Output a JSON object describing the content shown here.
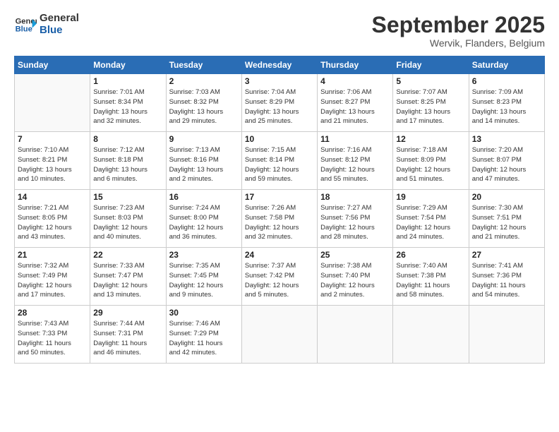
{
  "logo": {
    "line1": "General",
    "line2": "Blue"
  },
  "title": "September 2025",
  "subtitle": "Wervik, Flanders, Belgium",
  "weekdays": [
    "Sunday",
    "Monday",
    "Tuesday",
    "Wednesday",
    "Thursday",
    "Friday",
    "Saturday"
  ],
  "weeks": [
    [
      {
        "day": "",
        "detail": ""
      },
      {
        "day": "1",
        "detail": "Sunrise: 7:01 AM\nSunset: 8:34 PM\nDaylight: 13 hours\nand 32 minutes."
      },
      {
        "day": "2",
        "detail": "Sunrise: 7:03 AM\nSunset: 8:32 PM\nDaylight: 13 hours\nand 29 minutes."
      },
      {
        "day": "3",
        "detail": "Sunrise: 7:04 AM\nSunset: 8:29 PM\nDaylight: 13 hours\nand 25 minutes."
      },
      {
        "day": "4",
        "detail": "Sunrise: 7:06 AM\nSunset: 8:27 PM\nDaylight: 13 hours\nand 21 minutes."
      },
      {
        "day": "5",
        "detail": "Sunrise: 7:07 AM\nSunset: 8:25 PM\nDaylight: 13 hours\nand 17 minutes."
      },
      {
        "day": "6",
        "detail": "Sunrise: 7:09 AM\nSunset: 8:23 PM\nDaylight: 13 hours\nand 14 minutes."
      }
    ],
    [
      {
        "day": "7",
        "detail": "Sunrise: 7:10 AM\nSunset: 8:21 PM\nDaylight: 13 hours\nand 10 minutes."
      },
      {
        "day": "8",
        "detail": "Sunrise: 7:12 AM\nSunset: 8:18 PM\nDaylight: 13 hours\nand 6 minutes."
      },
      {
        "day": "9",
        "detail": "Sunrise: 7:13 AM\nSunset: 8:16 PM\nDaylight: 13 hours\nand 2 minutes."
      },
      {
        "day": "10",
        "detail": "Sunrise: 7:15 AM\nSunset: 8:14 PM\nDaylight: 12 hours\nand 59 minutes."
      },
      {
        "day": "11",
        "detail": "Sunrise: 7:16 AM\nSunset: 8:12 PM\nDaylight: 12 hours\nand 55 minutes."
      },
      {
        "day": "12",
        "detail": "Sunrise: 7:18 AM\nSunset: 8:09 PM\nDaylight: 12 hours\nand 51 minutes."
      },
      {
        "day": "13",
        "detail": "Sunrise: 7:20 AM\nSunset: 8:07 PM\nDaylight: 12 hours\nand 47 minutes."
      }
    ],
    [
      {
        "day": "14",
        "detail": "Sunrise: 7:21 AM\nSunset: 8:05 PM\nDaylight: 12 hours\nand 43 minutes."
      },
      {
        "day": "15",
        "detail": "Sunrise: 7:23 AM\nSunset: 8:03 PM\nDaylight: 12 hours\nand 40 minutes."
      },
      {
        "day": "16",
        "detail": "Sunrise: 7:24 AM\nSunset: 8:00 PM\nDaylight: 12 hours\nand 36 minutes."
      },
      {
        "day": "17",
        "detail": "Sunrise: 7:26 AM\nSunset: 7:58 PM\nDaylight: 12 hours\nand 32 minutes."
      },
      {
        "day": "18",
        "detail": "Sunrise: 7:27 AM\nSunset: 7:56 PM\nDaylight: 12 hours\nand 28 minutes."
      },
      {
        "day": "19",
        "detail": "Sunrise: 7:29 AM\nSunset: 7:54 PM\nDaylight: 12 hours\nand 24 minutes."
      },
      {
        "day": "20",
        "detail": "Sunrise: 7:30 AM\nSunset: 7:51 PM\nDaylight: 12 hours\nand 21 minutes."
      }
    ],
    [
      {
        "day": "21",
        "detail": "Sunrise: 7:32 AM\nSunset: 7:49 PM\nDaylight: 12 hours\nand 17 minutes."
      },
      {
        "day": "22",
        "detail": "Sunrise: 7:33 AM\nSunset: 7:47 PM\nDaylight: 12 hours\nand 13 minutes."
      },
      {
        "day": "23",
        "detail": "Sunrise: 7:35 AM\nSunset: 7:45 PM\nDaylight: 12 hours\nand 9 minutes."
      },
      {
        "day": "24",
        "detail": "Sunrise: 7:37 AM\nSunset: 7:42 PM\nDaylight: 12 hours\nand 5 minutes."
      },
      {
        "day": "25",
        "detail": "Sunrise: 7:38 AM\nSunset: 7:40 PM\nDaylight: 12 hours\nand 2 minutes."
      },
      {
        "day": "26",
        "detail": "Sunrise: 7:40 AM\nSunset: 7:38 PM\nDaylight: 11 hours\nand 58 minutes."
      },
      {
        "day": "27",
        "detail": "Sunrise: 7:41 AM\nSunset: 7:36 PM\nDaylight: 11 hours\nand 54 minutes."
      }
    ],
    [
      {
        "day": "28",
        "detail": "Sunrise: 7:43 AM\nSunset: 7:33 PM\nDaylight: 11 hours\nand 50 minutes."
      },
      {
        "day": "29",
        "detail": "Sunrise: 7:44 AM\nSunset: 7:31 PM\nDaylight: 11 hours\nand 46 minutes."
      },
      {
        "day": "30",
        "detail": "Sunrise: 7:46 AM\nSunset: 7:29 PM\nDaylight: 11 hours\nand 42 minutes."
      },
      {
        "day": "",
        "detail": ""
      },
      {
        "day": "",
        "detail": ""
      },
      {
        "day": "",
        "detail": ""
      },
      {
        "day": "",
        "detail": ""
      }
    ]
  ]
}
